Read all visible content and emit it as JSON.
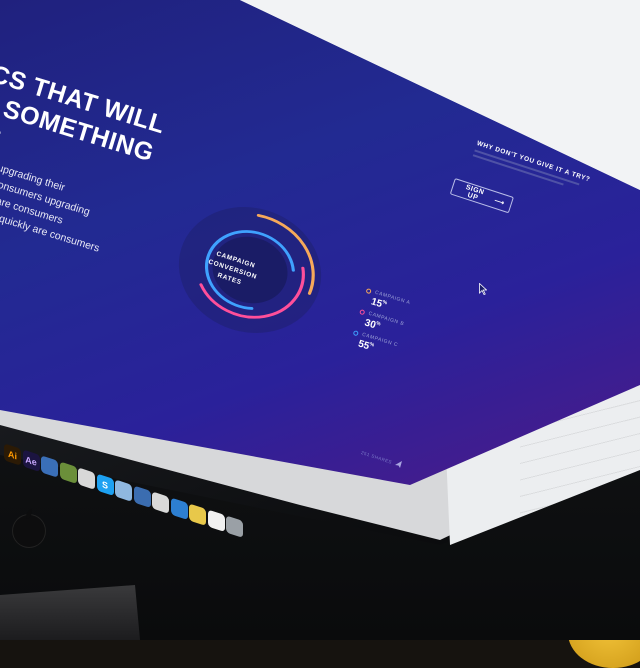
{
  "hero": {
    "headline_1": "CS THAT WILL",
    "headline_2": "U SOMETHING",
    "headline_3": "NG",
    "bullet_1": "upgrading their",
    "bullet_2": "consumers upgrading",
    "bullet_3": "y are consumers",
    "bullet_4": "ow quickly are consumers"
  },
  "cta": {
    "title": "WHY DON'T YOU GIVE IT A TRY?",
    "button_label": "SIGN UP",
    "button_arrow": "⟶"
  },
  "chart_data": {
    "type": "pie",
    "title": "CAMPAIGN CONVERSION RATES",
    "categories": [
      "CAMPAIGN A",
      "CAMPAIGN B",
      "CAMPAIGN C"
    ],
    "values": [
      15,
      30,
      55
    ],
    "unit": "%",
    "colors": [
      "#f7a95a",
      "#ff4f9a",
      "#3fa2ff"
    ],
    "center_line_1": "CAMPAIGN",
    "center_line_2": "CONVERSION",
    "center_line_3": "RATES",
    "legend": [
      {
        "name": "CAMPAIGN A",
        "value": "15",
        "suffix": "%"
      },
      {
        "name": "CAMPAIGN B",
        "value": "30",
        "suffix": "%"
      },
      {
        "name": "CAMPAIGN C",
        "value": "55",
        "suffix": "%"
      }
    ]
  },
  "footer": {
    "shares": "251 SHARES"
  },
  "dock": {
    "apps": [
      {
        "label": "Ai",
        "bg": "#2b1a05",
        "fg": "#ff9a00"
      },
      {
        "label": "Ae",
        "bg": "#1b1440",
        "fg": "#c9a8ff"
      },
      {
        "label": "",
        "bg": "#3a6fb8",
        "fg": "#ffffff"
      },
      {
        "label": "",
        "bg": "#6b8f3a",
        "fg": "#ffffff"
      },
      {
        "label": "",
        "bg": "#d8d8d8",
        "fg": "#333333"
      },
      {
        "label": "S",
        "bg": "#1da1f2",
        "fg": "#ffffff"
      },
      {
        "label": "",
        "bg": "#8fb8e0",
        "fg": "#ffffff"
      },
      {
        "label": "",
        "bg": "#3b6db0",
        "fg": "#ffffff"
      },
      {
        "label": "",
        "bg": "#d9d9d9",
        "fg": "#555555"
      },
      {
        "label": "",
        "bg": "#2d7fd2",
        "fg": "#ffffff"
      },
      {
        "label": "",
        "bg": "#e8c84a",
        "fg": "#333333"
      },
      {
        "label": "",
        "bg": "#f1f1f1",
        "fg": "#555555"
      },
      {
        "label": "",
        "bg": "#9aa0a6",
        "fg": "#ffffff"
      }
    ]
  }
}
